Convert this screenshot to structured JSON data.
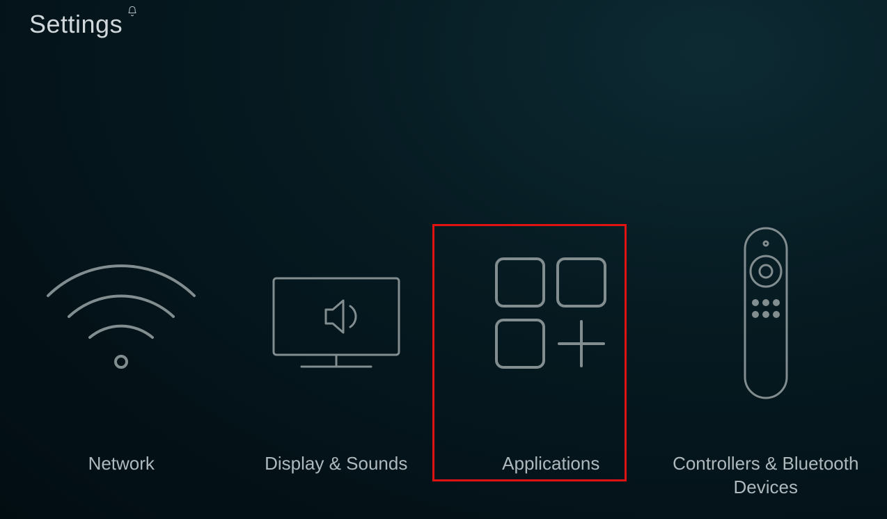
{
  "header": {
    "title": "Settings"
  },
  "tiles": [
    {
      "label": "Network",
      "icon": "wifi-icon"
    },
    {
      "label": "Display & Sounds",
      "icon": "tv-sound-icon"
    },
    {
      "label": "Applications",
      "icon": "apps-icon"
    },
    {
      "label": "Controllers & Bluetooth Devices",
      "icon": "remote-icon"
    }
  ],
  "highlighted_tile_index": 2,
  "colors": {
    "highlight": "#e11212",
    "icon_stroke": "#828d90",
    "text": "#aeb9bd"
  }
}
